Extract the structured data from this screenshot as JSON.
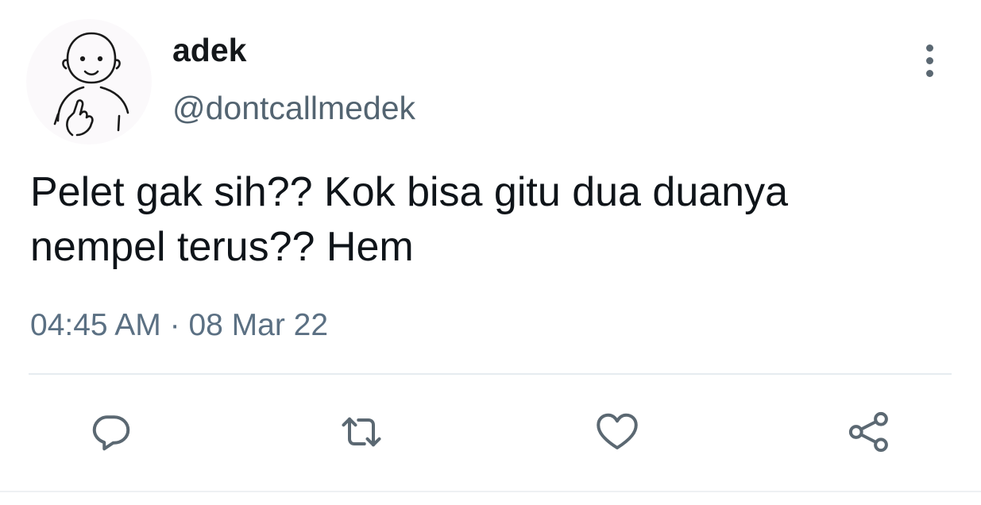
{
  "tweet": {
    "display_name": "adek",
    "handle": "@dontcallmedek",
    "text": "Pelet gak sih?? Kok bisa gitu dua duanya\nnempel terus??  Hem",
    "time": "04:45 AM",
    "separator": "·",
    "date": "08 Mar 22"
  },
  "icons": {
    "avatar": "cartoon-person-avatar",
    "more": "vertical-ellipsis-icon",
    "reply": "reply-bubble-icon",
    "retweet": "retweet-icon",
    "like": "heart-icon",
    "share": "share-icon"
  },
  "colors": {
    "text_primary": "#0f1419",
    "text_secondary": "#536471",
    "icon": "#5b6872",
    "divider": "#e6ecf0"
  }
}
